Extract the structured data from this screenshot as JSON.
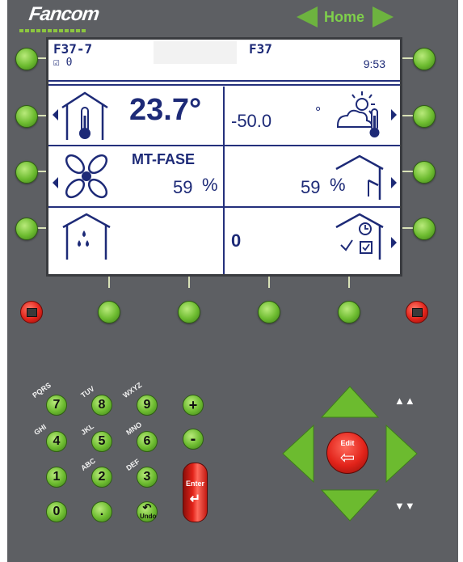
{
  "brand": "Fancom",
  "home": {
    "label": "Home"
  },
  "screen": {
    "header": {
      "code": "F37-7",
      "check_count": "☑ 0",
      "title": "F37",
      "time": "9:53"
    },
    "cells": {
      "inside_temp": "23.7°",
      "outside_temp": "-50.0",
      "outside_unit": "°",
      "fan_mode": "MT-FASE",
      "fan_value": "59",
      "fan_unit": "%",
      "inlet_value": "59",
      "inlet_unit": "%",
      "alarm_value": "0"
    }
  },
  "keypad": {
    "keys": [
      {
        "digit": "7",
        "letters": "PQRS"
      },
      {
        "digit": "8",
        "letters": "TUV"
      },
      {
        "digit": "9",
        "letters": "WXYZ"
      },
      {
        "digit": "4",
        "letters": "GHI"
      },
      {
        "digit": "5",
        "letters": "JKL"
      },
      {
        "digit": "6",
        "letters": "MNO"
      },
      {
        "digit": "1",
        "letters": ""
      },
      {
        "digit": "2",
        "letters": "ABC"
      },
      {
        "digit": "3",
        "letters": "DEF"
      },
      {
        "digit": "0",
        "letters": ""
      },
      {
        "digit": ".",
        "letters": ""
      }
    ],
    "plus": "+",
    "minus": "-",
    "enter": "Enter",
    "enter_glyph": "↵",
    "undo": "Undo",
    "undo_glyph": "↶"
  },
  "navpad": {
    "edit": "Edit",
    "edit_glyph": "⇦",
    "page_up": "▲▲",
    "page_down": "▼▼"
  },
  "colors": {
    "panel": "#5d5f63",
    "button_green": "#6cbb2f",
    "button_red": "#e2231a",
    "screen_text": "#1d2a77"
  },
  "icons": [
    "house-thermometer-icon",
    "sun-cloud-thermometer-icon",
    "fan-icon",
    "house-inlet-icon",
    "house-water-icon",
    "house-clock-icon",
    "scroll-left-icon",
    "scroll-right-icon"
  ]
}
